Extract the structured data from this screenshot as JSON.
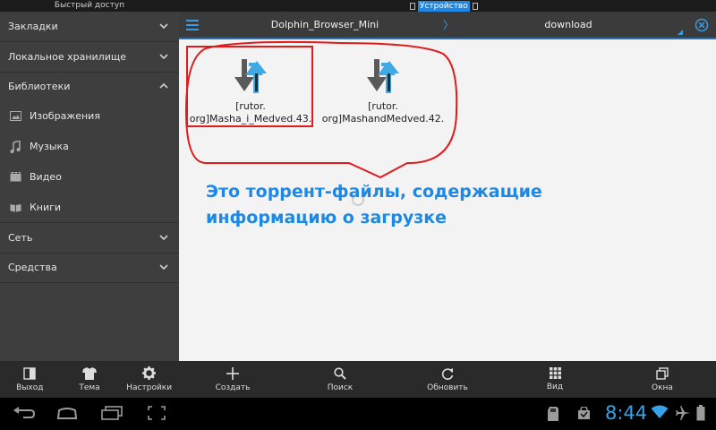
{
  "status": {
    "left_title": "Быстрый доступ",
    "device_label": "Устройство"
  },
  "sidebar": {
    "bookmarks": "Закладки",
    "local_storage": "Локальное хранилище",
    "libraries": "Библиотеки",
    "lib_items": [
      {
        "label": "Изображения",
        "icon": "image-icon"
      },
      {
        "label": "Музыка",
        "icon": "music-note-icon"
      },
      {
        "label": "Видео",
        "icon": "video-icon"
      },
      {
        "label": "Книги",
        "icon": "book-icon"
      }
    ],
    "network": "Сеть",
    "tools": "Средства",
    "bottom": {
      "exit": "Выход",
      "theme": "Тема",
      "settings": "Настройки"
    }
  },
  "toolbar": {
    "crumb1": "Dolphin_Browser_Mini",
    "separator": "〉",
    "crumb2": "download"
  },
  "files": [
    {
      "line1": "[rutor.",
      "line2": "org]Masha_i_Medved.43."
    },
    {
      "line1": "[rutor.",
      "line2": "org]MashandMedved.42."
    }
  ],
  "annotation": {
    "line1": "Это торрент-файлы, содержащие",
    "line2": "информацию о загрузке"
  },
  "actions": {
    "create": "Создать",
    "search": "Поиск",
    "refresh": "Обновить",
    "view": "Вид",
    "windows": "Окна"
  },
  "system": {
    "time": "8:44"
  },
  "colors": {
    "accent": "#1e88e5",
    "clock": "#36a3e8",
    "highlight": "#e01b1b",
    "sidebar_bg": "#3e3e3e",
    "content_bg": "#f3f3f3"
  }
}
